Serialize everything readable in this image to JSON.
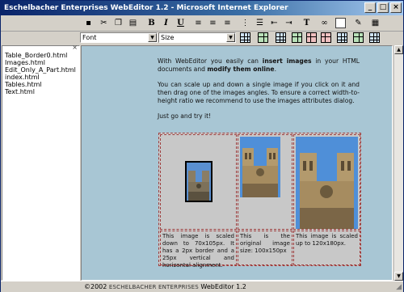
{
  "window": {
    "title": "Eschelbacher Enterprises WebEditor 1.2 - Microsoft Internet Explorer",
    "buttons": [
      "_",
      "□",
      "×"
    ]
  },
  "toolbar": {
    "format": {
      "bold": "B",
      "italic": "I",
      "underline": "U"
    },
    "icons": [
      "save-icon",
      "cut-icon",
      "copy-icon",
      "paste-icon",
      "bold-icon",
      "italic-icon",
      "underline-icon",
      "align-left-icon",
      "align-center-icon",
      "align-right-icon",
      "justify-icon",
      "numbered-list-icon",
      "bulleted-list-icon",
      "outdent-icon",
      "indent-icon",
      "text-color-icon",
      "link-icon",
      "insert-image-icon",
      "edit-icon"
    ]
  },
  "font_select": {
    "value": "Font"
  },
  "size_select": {
    "value": "Size"
  },
  "files": {
    "items": [
      "Table_Border0.html",
      "Images.html",
      "Edit_Only_A_Part.html",
      "index.html",
      "Tables.html",
      "Text.html"
    ]
  },
  "document": {
    "p1": {
      "t1": "With WebEditor you easily can ",
      "b1": "insert images",
      "t2": " in your HTML documents and ",
      "b2": "modify them online",
      "t3": "."
    },
    "p2": "You can scale up and down a single image if you click on it and then drag one of the images angles. To ensure a correct width-to-height ratio we recommend to use the images attributes dialog.",
    "p3": "Just go and try it!",
    "captions": [
      "This image is scaled down to 70x105px. It has a 2px border and a 25px vertical and horizontal alignment.",
      "This is the original image size: 100x150px",
      "This image is scaled up to 120x180px."
    ]
  },
  "status": {
    "prefix": "©2002 ",
    "company": "ESCHELBACHER ENTERPRISES",
    "suffix": " WebEditor 1.2"
  },
  "colors": {
    "editor_bg": "#a8c6d4",
    "title_gradient_start": "#0a246a",
    "dashed_border": "#a04040"
  }
}
